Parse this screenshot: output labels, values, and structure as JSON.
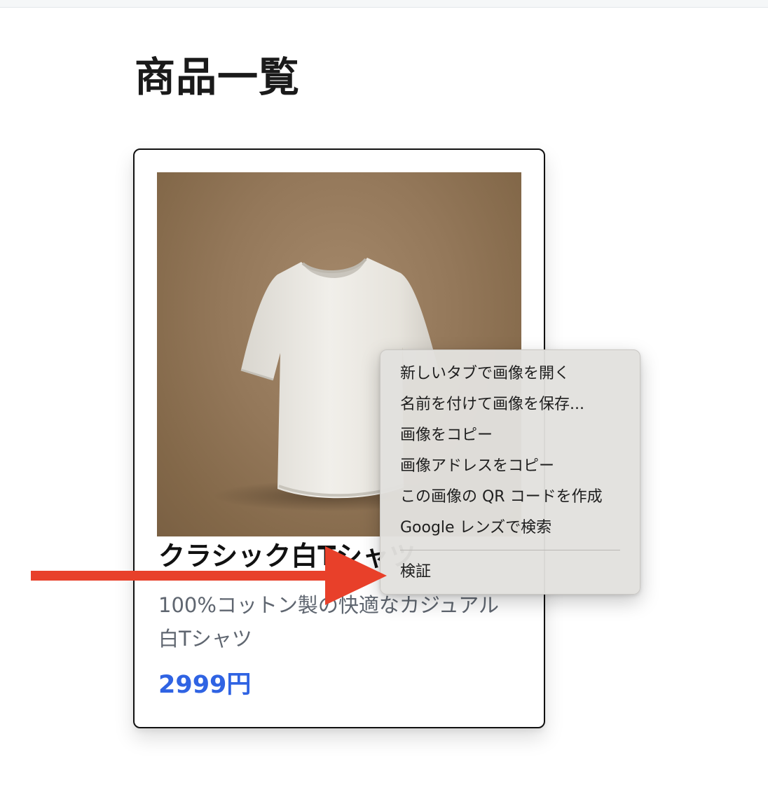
{
  "page": {
    "title": "商品一覧"
  },
  "product": {
    "name": "クラシック白Tシャツ",
    "description": "100%コットン製の快適なカジュアル白Tシャツ",
    "price": "2999円"
  },
  "context_menu": {
    "items": [
      {
        "label": "新しいタブで画像を開く"
      },
      {
        "label": "名前を付けて画像を保存..."
      },
      {
        "label": "画像をコピー"
      },
      {
        "label": "画像アドレスをコピー"
      },
      {
        "label": "この画像の QR コードを作成"
      },
      {
        "label": "Google レンズで検索"
      },
      {
        "label": "検証"
      }
    ]
  },
  "colors": {
    "price": "#2f63e3",
    "arrow": "#e8402a",
    "menu_background": "#e2e1de"
  }
}
